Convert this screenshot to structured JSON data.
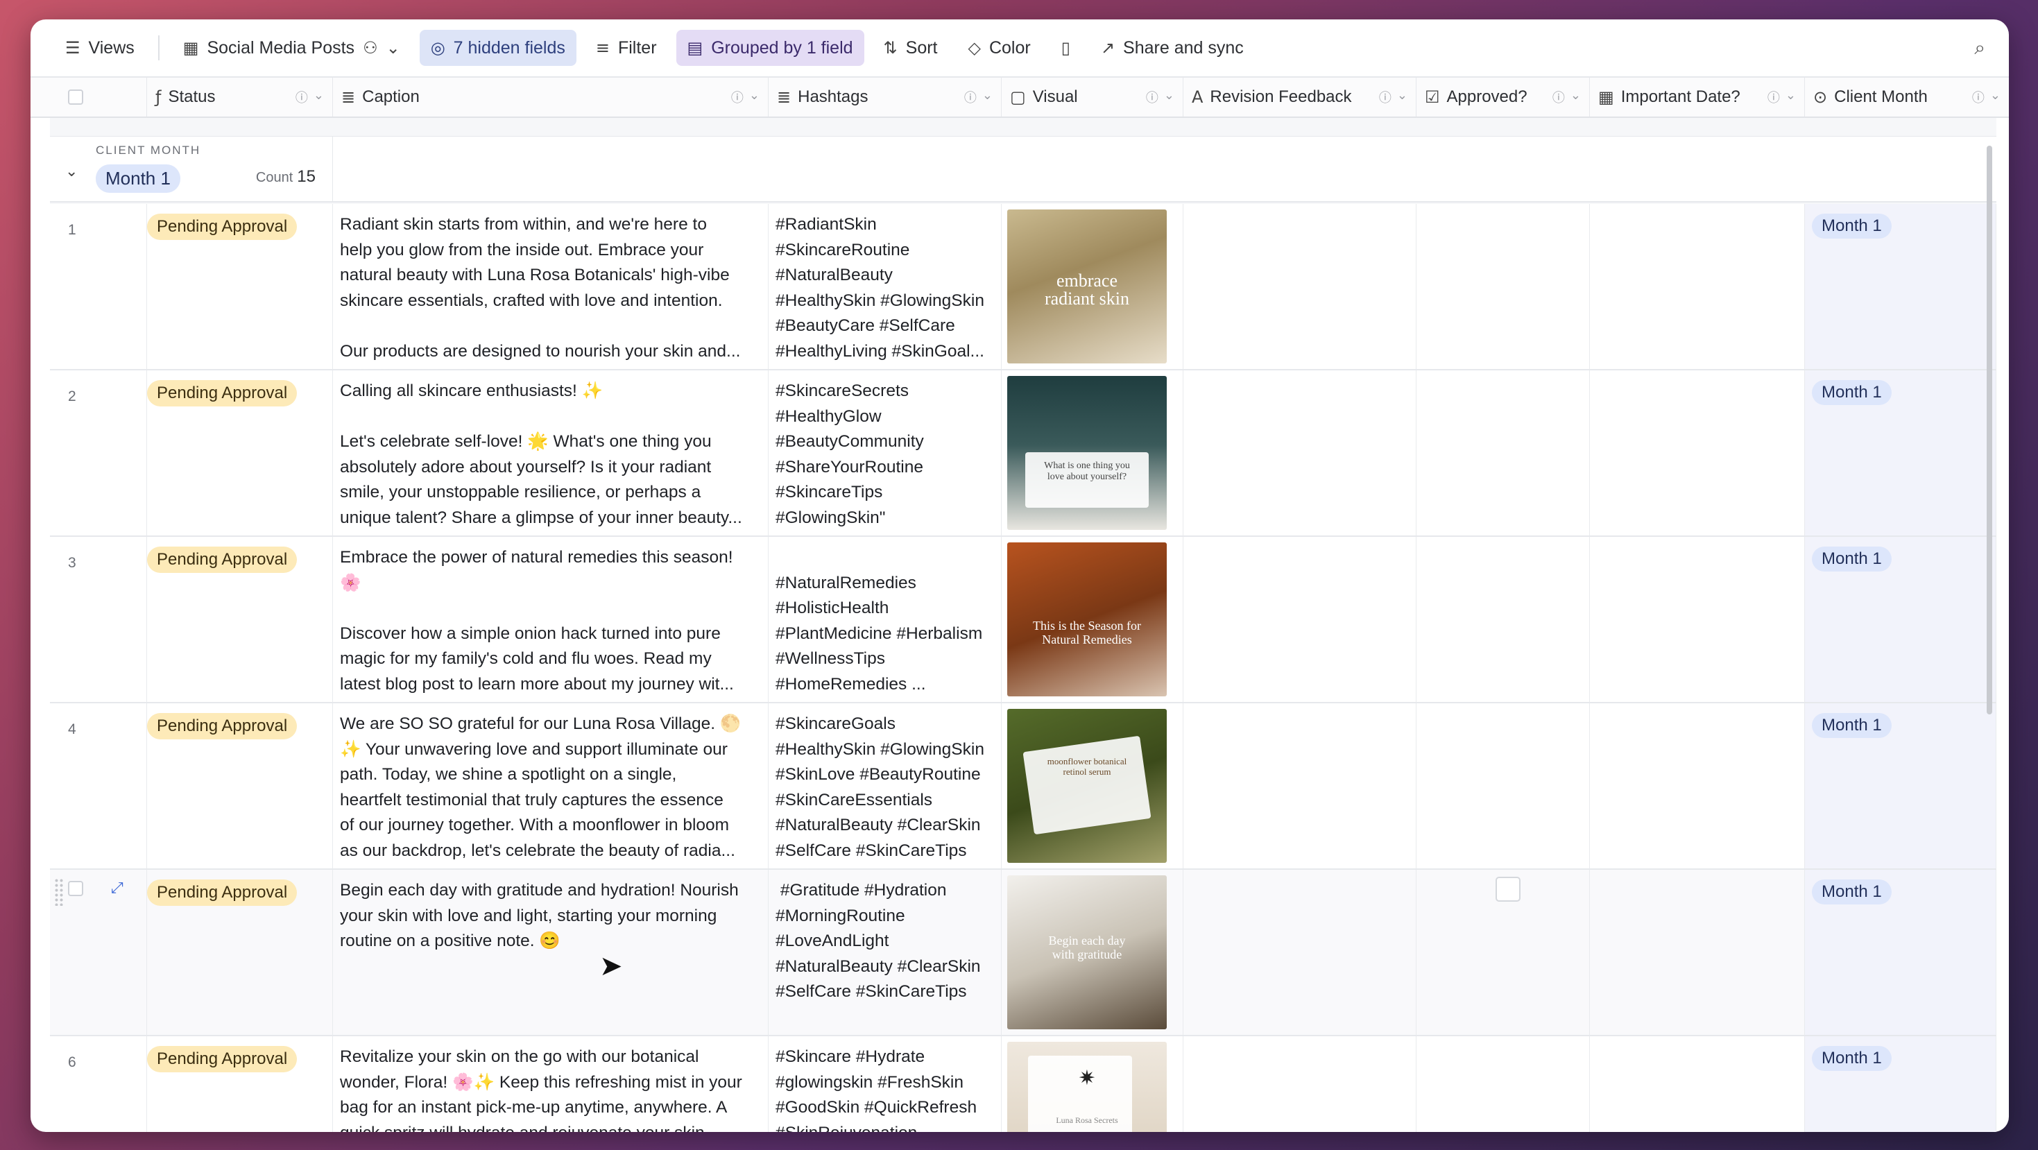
{
  "toolbar": {
    "views_label": "Views",
    "table_name": "Social Media Posts",
    "hidden_fields_label": "7 hidden fields",
    "filter_label": "Filter",
    "grouped_label": "Grouped by 1 field",
    "sort_label": "Sort",
    "color_label": "Color",
    "share_label": "Share and sync"
  },
  "columns": {
    "status": "Status",
    "caption": "Caption",
    "hashtags": "Hashtags",
    "visual": "Visual",
    "revision": "Revision Feedback",
    "approved": "Approved?",
    "important_date": "Important Date?",
    "client_month": "Client Month"
  },
  "group": {
    "label": "CLIENT MONTH",
    "value": "Month 1",
    "count_label": "Count",
    "count_value": "15"
  },
  "rows": [
    {
      "num": "1",
      "status": "Pending Approval",
      "caption": "Radiant skin starts from within, and we're here to\nhelp you glow from the inside out. Embrace your\nnatural beauty with Luna Rosa Botanicals' high-vibe\nskincare essentials, crafted with love and intention.\n\nOur products are designed to nourish your skin and...",
      "hashtags": "#RadiantSkin\n#SkincareRoutine\n#NaturalBeauty\n#HealthySkin #GlowingSkin\n#BeautyCare #SelfCare\n#HealthyLiving #SkinGoal...",
      "visual_text": "embrace\nradiant skin",
      "month": "Month 1"
    },
    {
      "num": "2",
      "status": "Pending Approval",
      "caption": "Calling all skincare enthusiasts! ✨\n\nLet's celebrate self-love! 🌟 What's one thing you\nabsolutely adore about yourself? Is it your radiant\nsmile, your unstoppable resilience, or perhaps a\nunique talent? Share a glimpse of your inner beauty...",
      "hashtags": "#SkincareSecrets\n#HealthyGlow\n#BeautyCommunity\n#ShareYourRoutine\n#SkincareTips\n#GlowingSkin\"",
      "visual_text": "What is one thing you\nlove about yourself?",
      "month": "Month 1"
    },
    {
      "num": "3",
      "status": "Pending Approval",
      "caption": "Embrace the power of natural remedies this season!\n🌸\n\nDiscover how a simple onion hack turned into pure\nmagic for my family's cold and flu woes. Read my\nlatest blog post to learn more about my journey wit...",
      "hashtags": "\n#NaturalRemedies\n#HolisticHealth\n#PlantMedicine #Herbalism\n#WellnessTips\n#HomeRemedies ...",
      "visual_text": "This is the Season for\nNatural Remedies",
      "month": "Month 1"
    },
    {
      "num": "4",
      "status": "Pending Approval",
      "caption": "We are SO SO grateful for our Luna Rosa Village. 🌕\n✨ Your unwavering love and support illuminate our\npath. Today, we shine a spotlight on a single,\nheartfelt testimonial that truly captures the essence\nof our journey together. With a moonflower in bloom\nas our backdrop, let's celebrate the beauty of radia...",
      "hashtags": "#SkincareGoals\n#HealthySkin #GlowingSkin\n#SkinLove #BeautyRoutine\n#SkinCareEssentials\n#NaturalBeauty #ClearSkin\n#SelfCare #SkinCareTips",
      "visual_text": "moonflower botanical\nretinol serum",
      "month": "Month 1"
    },
    {
      "num": "",
      "status": "Pending Approval",
      "caption": "Begin each day with gratitude and hydration! Nourish\nyour skin with love and light, starting your morning\nroutine on a positive note. 😊",
      "hashtags": " #Gratitude #Hydration\n#MorningRoutine\n#LoveAndLight\n#NaturalBeauty #ClearSkin\n#SelfCare #SkinCareTips",
      "visual_text": "Begin each day\nwith gratitude",
      "month": "Month 1"
    },
    {
      "num": "6",
      "status": "Pending Approval",
      "caption": "Revitalize your skin on the go with our botanical\nwonder, Flora! 🌸✨ Keep this refreshing mist in your\nbag for an instant pick-me-up anytime, anywhere. A\nquick spritz will hydrate and rejuvenate your skin...",
      "hashtags": "#Skincare #Hydrate\n#glowingskin #FreshSkin\n#GoodSkin #QuickRefresh\n#SkinRejuvenation",
      "visual_text": "Luna Rosa Secrets",
      "month": "Month 1"
    }
  ],
  "icons": {
    "views": "menu-icon",
    "table": "grid-icon",
    "hidden": "eye-slash-icon",
    "filter": "filter-icon",
    "group": "group-icon",
    "sort": "sort-icon",
    "color": "paint-bucket-icon",
    "share": "share-icon",
    "search": "search-icon"
  }
}
